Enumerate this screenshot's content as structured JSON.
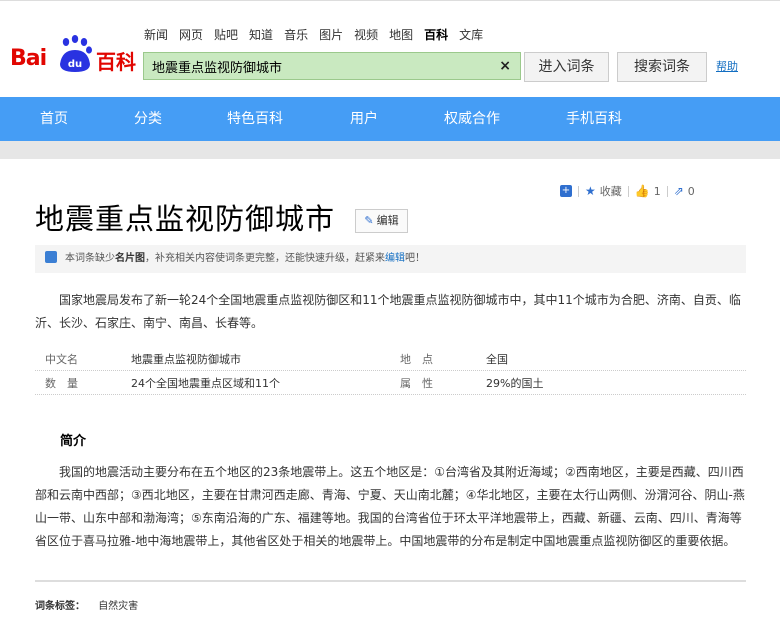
{
  "brand": {
    "part1": "Bai",
    "part2": "du",
    "part3": "百科"
  },
  "top_nav": [
    {
      "label": "新闻",
      "active": false
    },
    {
      "label": "网页",
      "active": false
    },
    {
      "label": "贴吧",
      "active": false
    },
    {
      "label": "知道",
      "active": false
    },
    {
      "label": "音乐",
      "active": false
    },
    {
      "label": "图片",
      "active": false
    },
    {
      "label": "视频",
      "active": false
    },
    {
      "label": "地图",
      "active": false
    },
    {
      "label": "百科",
      "active": true
    },
    {
      "label": "文库",
      "active": false
    }
  ],
  "search": {
    "value": "地震重点监视防御城市",
    "clear_icon": "×"
  },
  "buttons": {
    "enter": "进入词条",
    "search": "搜索词条",
    "help": "帮助"
  },
  "main_nav": [
    "首页",
    "分类",
    "特色百科",
    "用户",
    "权威合作",
    "手机百科"
  ],
  "tools": {
    "collect_label": "收藏",
    "like_count": "1",
    "share_count": "0"
  },
  "entry": {
    "title": "地震重点监视防御城市",
    "edit_label": "编辑",
    "notice": {
      "prefix": "本词条缺少",
      "bold": "名片图",
      "middle": "，补充相关内容使词条更完整，还能快速升级，赶紧来",
      "link": "编辑",
      "suffix": "吧！"
    },
    "summary": "国家地震局发布了新一轮24个全国地震重点监视防御区和11个地震重点监视防御城市中，其中11个城市为合肥、济南、自贡、临沂、长沙、石家庄、南宁、南昌、长春等。",
    "info": [
      {
        "k1": "中文名",
        "v1": "地震重点监视防御城市",
        "k2": "地　点",
        "v2": "全国"
      },
      {
        "k1": "数　量",
        "v1": "24个全国地震重点区域和11个",
        "k2": "属　性",
        "v2": "29%的国土"
      }
    ],
    "section_title": "简介",
    "intro": "我国的地震活动主要分布在五个地区的23条地震带上。这五个地区是：①台湾省及其附近海域；②西南地区，主要是西藏、四川西部和云南中西部；③西北地区，主要在甘肃河西走廊、青海、宁夏、天山南北麓；④华北地区，主要在太行山两侧、汾渭河谷、阴山-燕山一带、山东中部和渤海湾；⑤东南沿海的广东、福建等地。我国的台湾省位于环太平洋地震带上，西藏、新疆、云南、四川、青海等省区位于喜马拉雅-地中海地震带上，其他省区处于相关的地震带上。中国地震带的分布是制定中国地震重点监视防御区的重要依据。",
    "tags_label": "词条标签：",
    "tags": [
      "自然灾害"
    ]
  },
  "colors": {
    "brand_red": "#e10601",
    "nav_blue": "#459df5",
    "search_bg": "#c9e9c0",
    "link_blue": "#136ec2"
  }
}
